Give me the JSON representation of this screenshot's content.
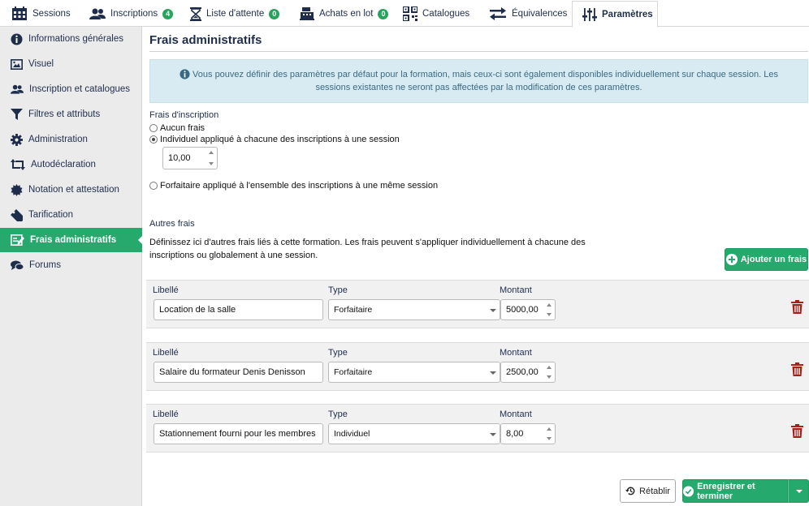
{
  "tabs": [
    {
      "label": "Sessions",
      "icon": "calendar-icon"
    },
    {
      "label": "Inscriptions",
      "icon": "users-icon",
      "badge": "4"
    },
    {
      "label": "Liste d'attente",
      "icon": "hourglass-icon",
      "badge": "0"
    },
    {
      "label": "Achats en lot",
      "icon": "register-icon",
      "badge": "0"
    },
    {
      "label": "Catalogues",
      "icon": "qrcode-icon"
    },
    {
      "label": "Équivalences",
      "icon": "exchange-icon"
    },
    {
      "label": "Paramètres",
      "icon": "sliders-icon",
      "active": true
    }
  ],
  "sidebar": {
    "items": [
      {
        "label": "Informations générales",
        "icon": "info-icon"
      },
      {
        "label": "Visuel",
        "icon": "image-icon"
      },
      {
        "label": "Inscription et catalogues",
        "icon": "users-icon"
      },
      {
        "label": "Filtres et attributs",
        "icon": "filter-icon"
      },
      {
        "label": "Administration",
        "icon": "gear-icon"
      },
      {
        "label": "Autodéclaration",
        "icon": "retweet-icon"
      },
      {
        "label": "Notation et attestation",
        "icon": "certificate-icon"
      },
      {
        "label": "Tarification",
        "icon": "tag-icon"
      },
      {
        "label": "Frais administratifs",
        "icon": "invoice-icon",
        "active": true
      },
      {
        "label": "Forums",
        "icon": "comments-icon"
      }
    ]
  },
  "main": {
    "title": "Frais administratifs",
    "info_text": "Vous pouvez définir des paramètres par défaut pour la formation, mais ceux-ci sont également disponibles individuellement sur chaque session. Les sessions existantes ne seront pas affectées par la modification de ces paramètres.",
    "registration_fee_label": "Frais d'inscription",
    "options": [
      {
        "label": "Aucun frais",
        "checked": false
      },
      {
        "label": "Individuel appliqué à chacune des inscriptions à une session",
        "checked": true
      },
      {
        "label": "Forfaitaire appliqué à l'ensemble des inscriptions à une même session",
        "checked": false
      }
    ],
    "individual_amount": "10,00",
    "other_fees_label": "Autres frais",
    "other_fees_desc": "Définissez ici d'autres frais liés à cette formation. Les frais peuvent s'appliquer individuellement à chacune des inscriptions ou globalement à une session.",
    "add_fee_label": "Ajouter un frais",
    "col_labels": {
      "libelle": "Libellé",
      "type": "Type",
      "montant": "Montant"
    },
    "fees": [
      {
        "libelle": "Location de la salle",
        "type": "Forfaitaire",
        "montant": "5000,00"
      },
      {
        "libelle": "Salaire du formateur Denis Denisson",
        "type": "Forfaitaire",
        "montant": "2500,00"
      },
      {
        "libelle": "Stationnement fourni pour les membres",
        "type": "Individuel",
        "montant": "8,00"
      }
    ],
    "reset_label": "Rétablir",
    "save_label": "Enregistrer et terminer"
  },
  "colors": {
    "accent": "#25a96d",
    "navy": "#1f2d4d",
    "danger": "#a8201a",
    "info_bg": "#d8ebf3"
  }
}
